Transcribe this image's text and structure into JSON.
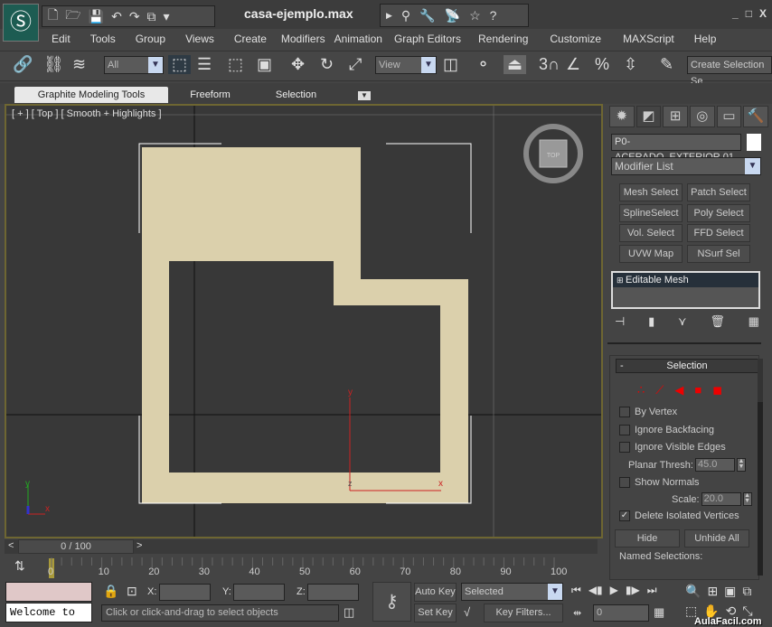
{
  "window": {
    "title": "casa-ejemplo.max",
    "minimize": "_",
    "maximize": "□",
    "close": "X"
  },
  "quick_access": [
    "new-icon",
    "open-icon",
    "save-icon",
    "undo-icon",
    "redo-icon",
    "project-icon"
  ],
  "infocenter": [
    "binoculars-icon",
    "key-icon",
    "satellite-icon",
    "star-icon",
    "help-icon"
  ],
  "menu": [
    "Edit",
    "Tools",
    "Group",
    "Views",
    "Create",
    "Modifiers",
    "Animation",
    "Graph Editors",
    "Rendering",
    "Customize",
    "MAXScript",
    "Help"
  ],
  "toolbar": {
    "selection_filter": "All",
    "reference_coord": "View",
    "named_selection_placeholder": "Create Selection Se"
  },
  "ribbon": {
    "tabs": [
      "Graphite Modeling Tools",
      "Freeform",
      "Selection"
    ],
    "active": "Graphite Modeling Tools"
  },
  "viewport": {
    "label": "[ + ] [ Top ] [ Smooth + Highlights ]",
    "viewcube_label": "TOP",
    "gizmo": {
      "x": "x",
      "y": "y",
      "z": "z"
    },
    "object_color": "#dbd0ac",
    "axis_tripod": {
      "x": "x",
      "y": "y",
      "z": "z"
    }
  },
  "command_panel": {
    "object_name": "P0-ACERADO_EXTERIOR.01",
    "object_color": "#ffffff",
    "modifier_list": "Modifier List",
    "modifier_buttons": [
      "Mesh Select",
      "Patch Select",
      "SplineSelect",
      "Poly Select",
      "Vol. Select",
      "FFD Select",
      "UVW Map",
      "NSurf Sel"
    ],
    "stack": [
      "Editable Mesh"
    ],
    "rollout": {
      "title": "Selection",
      "collapse": "-",
      "by_vertex": {
        "label": "By Vertex",
        "checked": false
      },
      "ignore_backfacing": {
        "label": "Ignore Backfacing",
        "checked": false
      },
      "ignore_visible_edges": {
        "label": "Ignore Visible Edges",
        "checked": false
      },
      "planar_thresh": {
        "label": "Planar Thresh:",
        "value": "45.0"
      },
      "show_normals": {
        "label": "Show Normals",
        "checked": false
      },
      "scale": {
        "label": "Scale:",
        "value": "20.0"
      },
      "delete_isolated": {
        "label": "Delete Isolated Vertices",
        "checked": true
      },
      "hide": "Hide",
      "unhide_all": "Unhide All",
      "named_selections": "Named Selections:"
    }
  },
  "timeline": {
    "position": "0 / 100",
    "prev": "<",
    "next": ">",
    "ticks": [
      "0",
      "10",
      "20",
      "30",
      "40",
      "50",
      "60",
      "70",
      "80",
      "90",
      "100"
    ]
  },
  "status": {
    "maxscript_text": "Welcome to",
    "prompt": "Click or click-and-drag to select objects",
    "x_label": "X:",
    "y_label": "Y:",
    "z_label": "Z:",
    "auto_key": "Auto Key",
    "set_key": "Set Key",
    "key_mode": "Selected",
    "key_filters": "Key Filters...",
    "current_frame": "0",
    "watermark": "AulaFacil.com"
  }
}
